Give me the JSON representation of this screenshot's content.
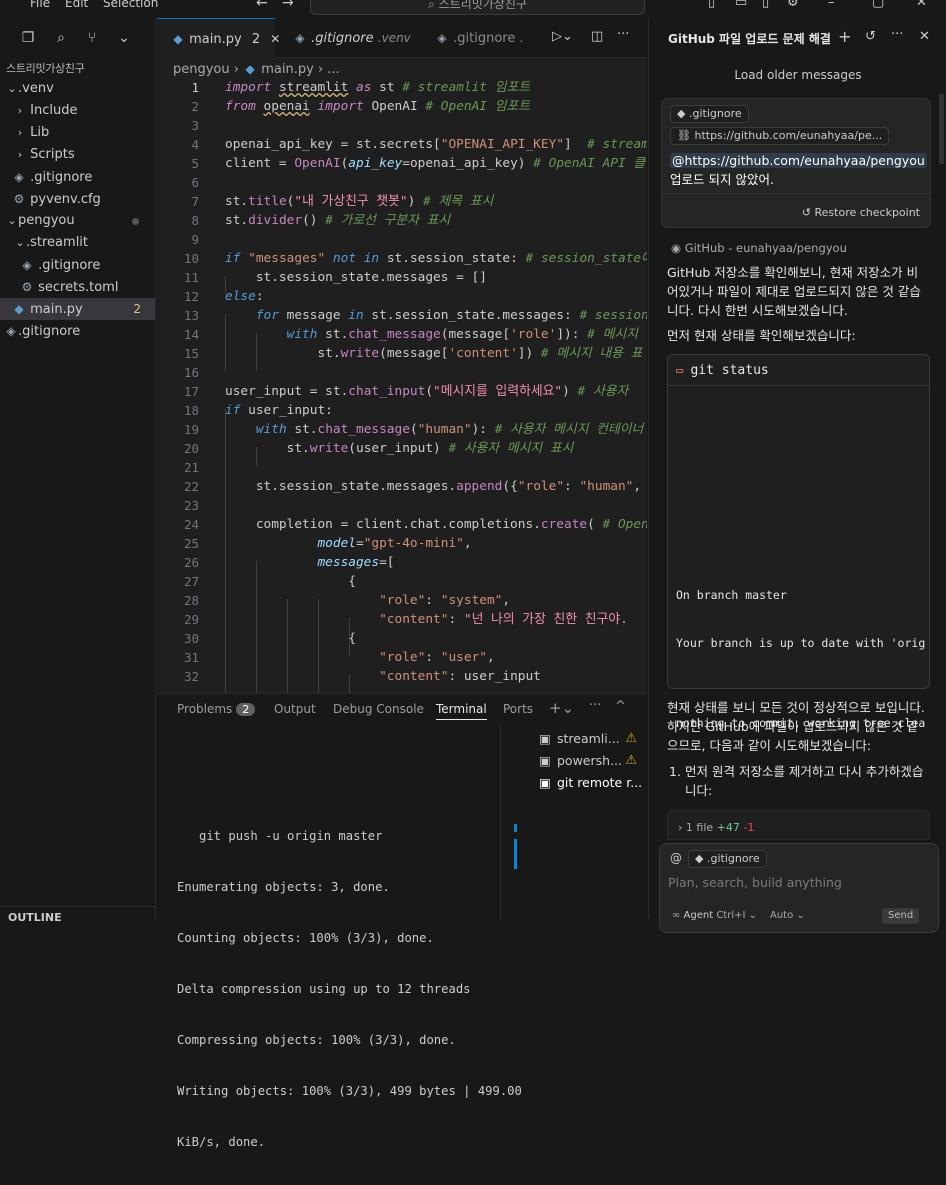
{
  "menu": {
    "file": "File",
    "edit": "Edit",
    "selection": "Selection"
  },
  "command_center": {
    "text": "스트리밋가상친구"
  },
  "explorer": {
    "root": "스트리밋가상친구",
    "items": [
      {
        "label": ".venv",
        "kind": "folder-open"
      },
      {
        "label": "Include",
        "kind": "folder"
      },
      {
        "label": "Lib",
        "kind": "folder"
      },
      {
        "label": "Scripts",
        "kind": "folder"
      },
      {
        "label": ".gitignore",
        "kind": "file"
      },
      {
        "label": "pyvenv.cfg",
        "kind": "file"
      },
      {
        "label": "pengyou",
        "kind": "folder-open"
      },
      {
        "label": ".streamlit",
        "kind": "folder-open"
      },
      {
        "label": ".gitignore",
        "kind": "file"
      },
      {
        "label": "secrets.toml",
        "kind": "file"
      },
      {
        "label": "main.py",
        "kind": "python",
        "badge": "2"
      },
      {
        "label": ".gitignore",
        "kind": "file"
      }
    ],
    "outline": "OUTLINE"
  },
  "editor": {
    "tabs": [
      {
        "label": "main.py",
        "badge": "2"
      },
      {
        "label": ".gitignore",
        "desc": ".venv"
      },
      {
        "label": ".gitignore",
        "desc": "."
      }
    ],
    "breadcrumb": {
      "folder": "pengyou",
      "file": "main.py",
      "rest": "..."
    },
    "line_numbers": [
      "1",
      "2",
      "3",
      "4",
      "5",
      "6",
      "7",
      "8",
      "9",
      "10",
      "11",
      "12",
      "13",
      "14",
      "15",
      "16",
      "17",
      "18",
      "19",
      "20",
      "21",
      "22",
      "23",
      "24",
      "25",
      "26",
      "27",
      "28",
      "29",
      "30",
      "31",
      "32"
    ]
  },
  "panel": {
    "tabs": {
      "problems": "Problems",
      "problems_count": "2",
      "output": "Output",
      "debug": "Debug Console",
      "terminal": "Terminal",
      "ports": "Ports"
    },
    "terminal_lines": [
      "   git push -u origin master",
      "Enumerating objects: 3, done.",
      "Counting objects: 100% (3/3), done.",
      "Delta compression using up to 12 threads",
      "Compressing objects: 100% (3/3), done.",
      "Writing objects: 100% (3/3), 499 bytes | 499.00",
      "KiB/s, done."
    ],
    "terminals": [
      {
        "label": "streamli..."
      },
      {
        "label": "powersh..."
      },
      {
        "label": "git remote r..."
      }
    ]
  },
  "chat": {
    "title": "GitHub 파일 업로드 문제 해결",
    "load_older": "Load older messages",
    "user_msg": {
      "chip1": ".gitignore",
      "chip2": "https://github.com/eunahyaa/pe...",
      "mention": "@https://github.com/eunahyaa/pengyou",
      "text_after": " 업로드 되지 않았어."
    },
    "restore": "Restore checkpoint",
    "source": "GitHub - eunahyaa/pengyou",
    "resp1": "GitHub 저장소를 확인해보니, 현재 저장소가 비어있거나 파일이 제대로 업로드되지 않은 것 같습니다. 다시 한번 시도해보겠습니다.",
    "resp2": "먼저 현재 상태를 확인해보겠습니다:",
    "command": "git status",
    "command_output": [
      "On branch master",
      "Your branch is up to date with 'origi",
      "",
      "nothing to commit, working tree clean"
    ],
    "resp3": "현재 상태를 보니 모든 것이 정상적으로 보입니다. 하지만 GitHub에 파일이 업로드되지 않은 것 같으므로, 다음과 같이 시도해보겠습니다:",
    "step1": "먼저 원격 저장소를 제거하고 다시 추가하겠습니다:",
    "diff": {
      "files": "1 file",
      "add": "+47",
      "del": "-1"
    },
    "input": {
      "chip": ".gitignore",
      "placeholder": "Plan, search, build anything",
      "mode": "Agent",
      "shortcut": "Ctrl+I",
      "model": "Auto",
      "send": "Send"
    }
  }
}
